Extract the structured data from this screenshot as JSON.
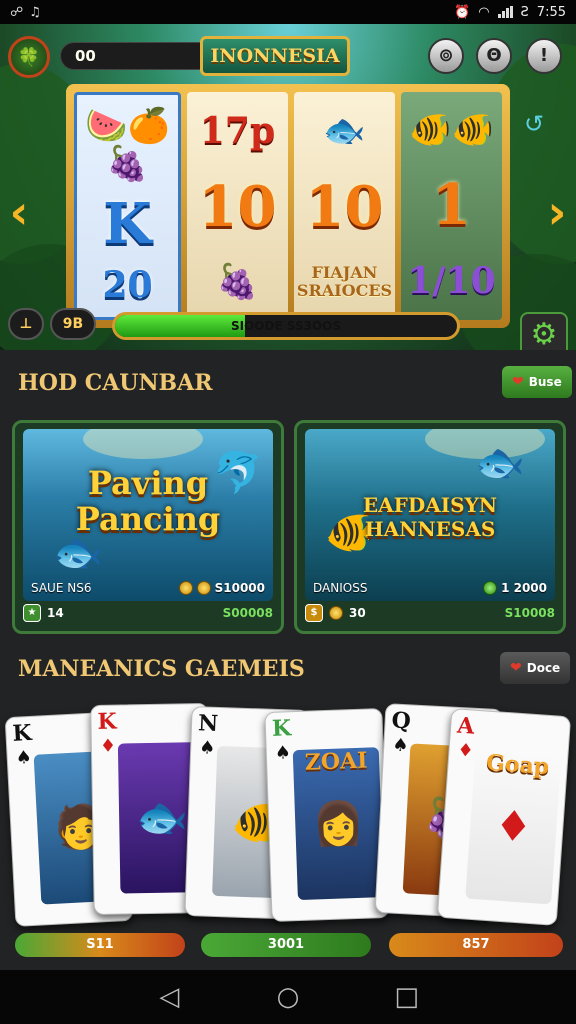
{
  "status": {
    "left_icons": [
      "link-icon",
      "vibrate-icon"
    ],
    "right_icons": [
      "alarm-icon",
      "wifi-icon",
      "signal-icon"
    ],
    "carrier": "Ƨ",
    "time": "7:55"
  },
  "header": {
    "balance": "00",
    "title": "INONNESIA",
    "btn1": "⊚",
    "btn2": "Θ",
    "btn3": "!"
  },
  "reels": {
    "col1": {
      "top": "🍉🍊🍇",
      "mid": "K",
      "bot": "20"
    },
    "col2": {
      "top": "17p",
      "mid": "10",
      "bot": "🍇"
    },
    "col3": {
      "top": "🐟",
      "mid": "10",
      "bot": "FIAJAN\nSRAIOCES"
    },
    "col4": {
      "top": "🐠🐠",
      "mid": "1",
      "bot": "1/10"
    }
  },
  "hud": {
    "btn_left": "⊥",
    "btn_left2": "9B",
    "progress_label": "SIOODE SS3OOS",
    "progress": 0.38
  },
  "section1": {
    "title": "HOD CAUNBAR",
    "pill": "Buse"
  },
  "game_cards": [
    {
      "title": "Paving Pancing",
      "label": "SAUE NS6",
      "coins": "S10000",
      "foot_count": "14",
      "foot_value": "S00008"
    },
    {
      "title": "EAFDAISYN HANNESAS",
      "label": "DANIOSS",
      "coins": "1 2000",
      "foot_count": "30",
      "foot_value": "S10008"
    }
  ],
  "section2": {
    "title": "MANEANICS GAEMEIS",
    "pill": "Doce"
  },
  "play_cards": [
    {
      "rank": "K",
      "suit": "♠",
      "pic": "🧑",
      "color": "#111"
    },
    {
      "rank": "K",
      "suit": "♦",
      "pic": "🐟",
      "color": "#d21a1a"
    },
    {
      "rank": "N",
      "suit": "♠",
      "pic": "🐠",
      "color": "#111"
    },
    {
      "rank": "K",
      "suit": "♠",
      "pic": "👩",
      "color": "#3aa040",
      "tag": "ZOAI"
    },
    {
      "rank": "Q",
      "suit": "♠",
      "pic": "🍇",
      "color": "#111"
    },
    {
      "rank": "A",
      "suit": "♦",
      "pic": "♦",
      "color": "#d21a1a",
      "tag": "Goap"
    }
  ],
  "values": {
    "v1": "S11",
    "v2": "3001",
    "v3": "857"
  },
  "colors": {
    "accent_gold": "#f0c773",
    "brand_green": "#3e7b3b",
    "progress_green": "#5eeb3c"
  }
}
